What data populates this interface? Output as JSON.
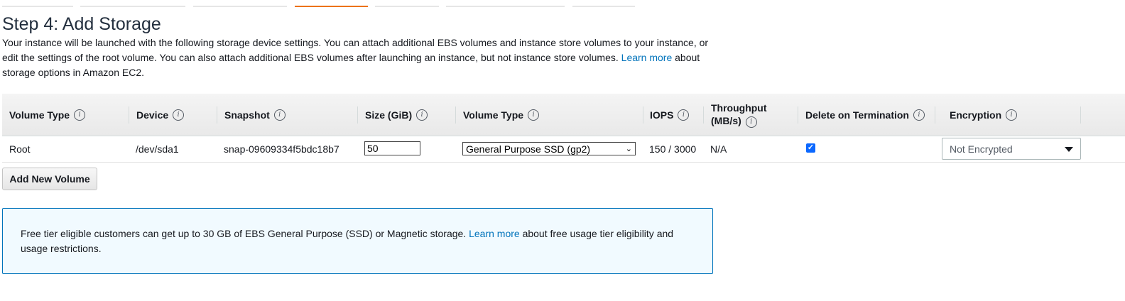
{
  "page": {
    "title": "Step 4: Add Storage",
    "description": {
      "part1": "Your instance will be launched with the following storage device settings. You can attach additional EBS volumes and instance store volumes to your instance, or edit the settings of the root volume. You can also attach additional EBS volumes after launching an instance, but not instance store volumes.",
      "link": "Learn more",
      "part2": "about storage options in Amazon EC2."
    }
  },
  "colors": {
    "link": "#0073bb",
    "active_tab": "#ec7211",
    "alert_border": "#0073bb",
    "alert_bg": "#f1faff"
  },
  "table": {
    "headers": {
      "volume_type": "Volume Type",
      "device": "Device",
      "snapshot": "Snapshot",
      "size": "Size (GiB)",
      "volume_type2": "Volume Type",
      "iops": "IOPS",
      "throughput_line1": "Throughput",
      "throughput_line2": "(MB/s)",
      "delete_on_termination": "Delete on Termination",
      "encryption": "Encryption"
    },
    "info_icon": "i",
    "row": {
      "volume_type": "Root",
      "device": "/dev/sda1",
      "snapshot": "snap-09609334f5bdc18b7",
      "size": "50",
      "volume_type_selected": "General Purpose SSD (gp2)",
      "iops": "150 / 3000",
      "throughput": "N/A",
      "delete_on_termination": true,
      "encryption_selected": "Not Encrypted"
    }
  },
  "buttons": {
    "add_new_volume": "Add New Volume"
  },
  "alert": {
    "part1": "Free tier eligible customers can get up to 30 GB of EBS General Purpose (SSD) or Magnetic storage.",
    "link": "Learn more",
    "part2": "about free usage tier eligibility and usage restrictions."
  }
}
